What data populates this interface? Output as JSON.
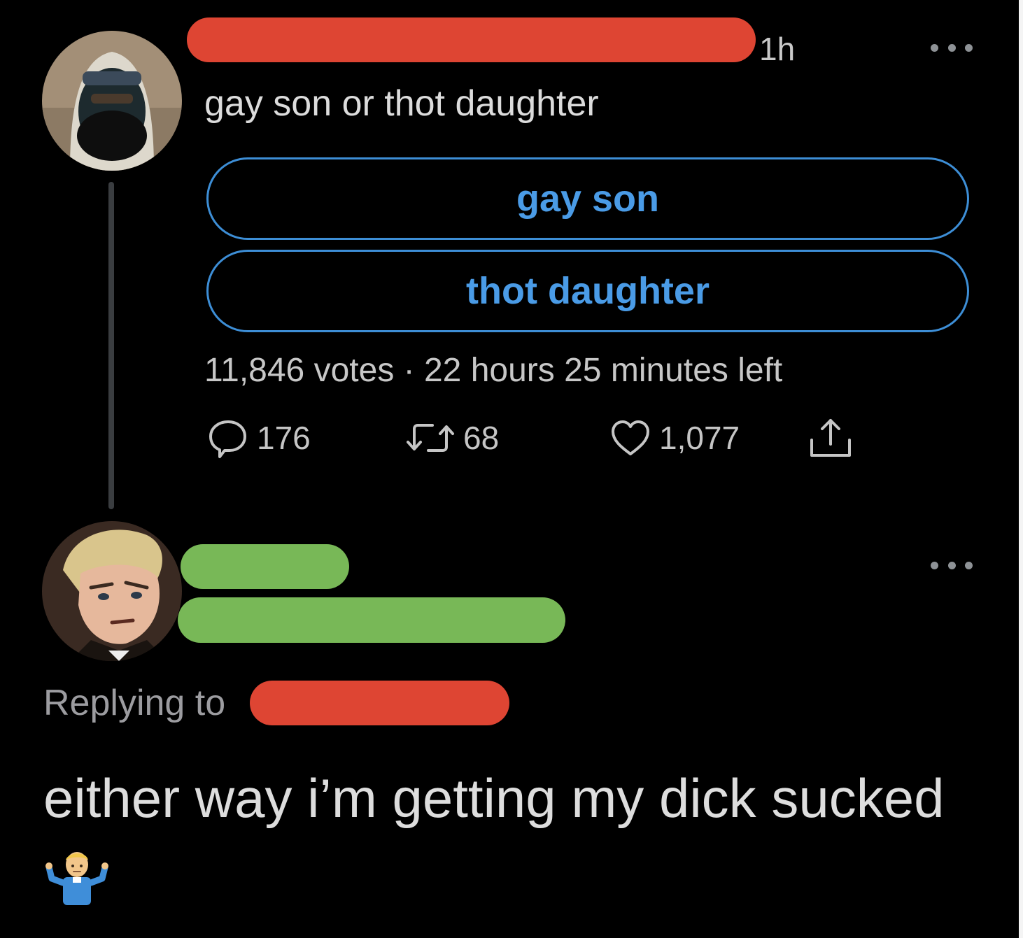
{
  "poll_tweet": {
    "time": "1h",
    "text": "gay son or thot daughter",
    "options": [
      "gay son",
      "thot daughter"
    ],
    "meta": "11,846 votes · 22 hours 25 minutes left",
    "counts": {
      "replies": "176",
      "retweets": "68",
      "likes": "1,077"
    }
  },
  "reply_tweet": {
    "replying_to_label": "Replying to",
    "text": "either way i’m getting my dick sucked"
  },
  "icons": {
    "more": "more-horizontal-icon",
    "reply": "comment-bubble-icon",
    "retweet": "retweet-icon",
    "like": "heart-icon",
    "share": "share-upload-icon",
    "emoji": "man-shrugging-emoji"
  },
  "colors": {
    "background": "#000000",
    "poll_accent": "#3d8ed6",
    "redaction_red": "#de4533",
    "redaction_green": "#78b857"
  }
}
